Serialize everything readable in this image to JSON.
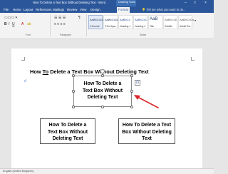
{
  "window": {
    "title": "How To Delete a Text Box Without Deleting Text - Word",
    "context_tab": "Drawing Tools",
    "min": "–",
    "max": "□",
    "close": "×"
  },
  "ribbon_tabs": [
    "File",
    "Home",
    "Layout",
    "References",
    "Mailings",
    "Review",
    "View",
    "Design",
    "Format"
  ],
  "tell_me": "Tell me what you want to do...",
  "ribbon": {
    "groups": [
      "Font",
      "Paragraph",
      "Styles"
    ],
    "styles": [
      {
        "sample": "AaBbCcDc",
        "name": "¶ Normal"
      },
      {
        "sample": "AaBbCcDc",
        "name": "¶ No Spac..."
      },
      {
        "sample": "AaBbCc",
        "name": "Heading 1"
      },
      {
        "sample": "AaBbCcC",
        "name": "Heading 2"
      },
      {
        "sample": "AaB",
        "name": "Title"
      },
      {
        "sample": "AaBbCcD",
        "name": "Subtitle"
      },
      {
        "sample": "AaBbCcDa",
        "name": "Subtle Em..."
      }
    ]
  },
  "document": {
    "heading_pre": "How ",
    "heading_ul": "To",
    "heading_post": " Delete a Text Box Without Deleting Text",
    "paragraph_mark": "↲",
    "textbox_selected": "How To Delete a Text Box Without Deleting Text",
    "textbox_left": "How To Delete a Text Box Without Deleting Text",
    "textbox_right": "How To Delete a Text Box Without Deleting Text",
    "layout_options_icon": "layout-options-icon"
  },
  "statusbar": {
    "language": "English (United Kingdom)"
  },
  "colors": {
    "word_blue": "#2b579a",
    "arrow_red": "#d9262a"
  }
}
